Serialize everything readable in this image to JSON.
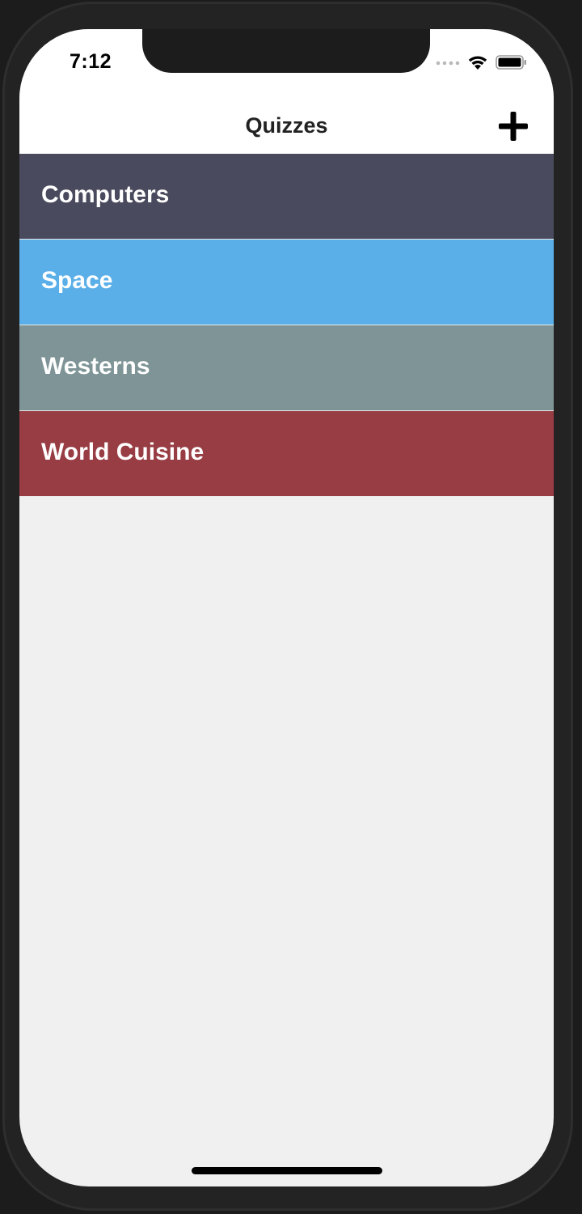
{
  "status_bar": {
    "time": "7:12"
  },
  "nav": {
    "title": "Quizzes",
    "add_icon": "plus-icon"
  },
  "quizzes": [
    {
      "label": "Computers",
      "color": "#494a5d"
    },
    {
      "label": "Space",
      "color": "#5aafe9"
    },
    {
      "label": "Westerns",
      "color": "#7e9496"
    },
    {
      "label": "World Cuisine",
      "color": "#973d43"
    }
  ],
  "colors": {
    "background": "#f0f0f0",
    "nav_background": "#ffffff"
  }
}
